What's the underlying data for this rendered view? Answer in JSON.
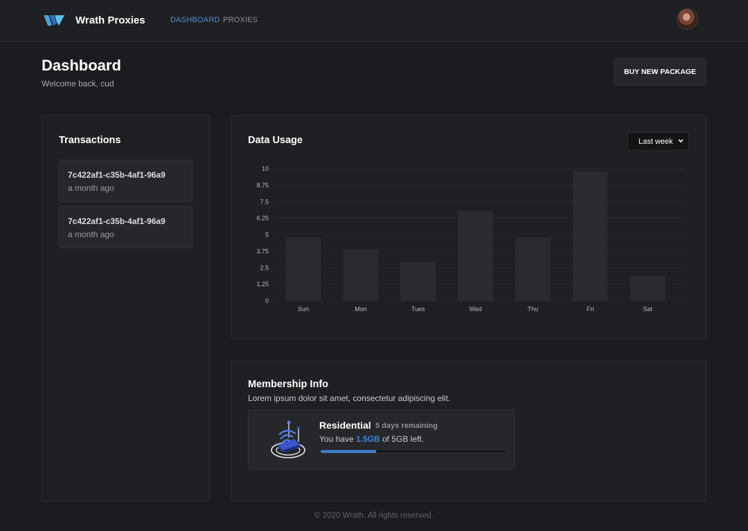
{
  "header": {
    "brand": "Wrath Proxies",
    "nav": [
      {
        "label": "DASHBOARD",
        "active": true
      },
      {
        "label": "PROXIES",
        "active": false
      }
    ]
  },
  "page": {
    "title": "Dashboard",
    "welcome": "Welcome back, cud",
    "buy_button": "BUY NEW PACKAGE"
  },
  "transactions": {
    "title": "Transactions",
    "items": [
      {
        "id": "7c422af1-c35b-4af1-96a9",
        "time": "a month ago"
      },
      {
        "id": "7c422af1-c35b-4af1-96a9",
        "time": "a month ago"
      }
    ]
  },
  "usage": {
    "title": "Data Usage",
    "range_selected": "Last week"
  },
  "chart_data": {
    "type": "bar",
    "categories": [
      "Sun",
      "Mon",
      "Tues",
      "Wed",
      "Thu",
      "Fri",
      "Sat"
    ],
    "values": [
      4.8,
      3.9,
      2.9,
      6.8,
      4.8,
      9.8,
      1.9
    ],
    "y_ticks": [
      "0",
      "1.25",
      "2.5",
      "3.75",
      "5",
      "6.25",
      "7.5",
      "8.75",
      "10"
    ],
    "ylim": [
      0,
      10
    ],
    "grid": true,
    "bar_color": "#2a2b2f"
  },
  "membership": {
    "title": "Membership Info",
    "description": "Lorem ipsum dolor sit amet, consectetur adipiscing elit.",
    "plan": {
      "name": "Residential",
      "remaining": "5 days remaining",
      "text_before": "You have",
      "amount_left": "1.5GB",
      "text_after": "of 5GB left.",
      "progress_fraction": 0.3
    },
    "icon": "router-wifi-icon"
  },
  "footer": {
    "text": "© 2020 Wrath. All rights reserved."
  },
  "colors": {
    "background": "#1b1c1f",
    "card": "#1f2023",
    "accent": "#3f86d9"
  }
}
